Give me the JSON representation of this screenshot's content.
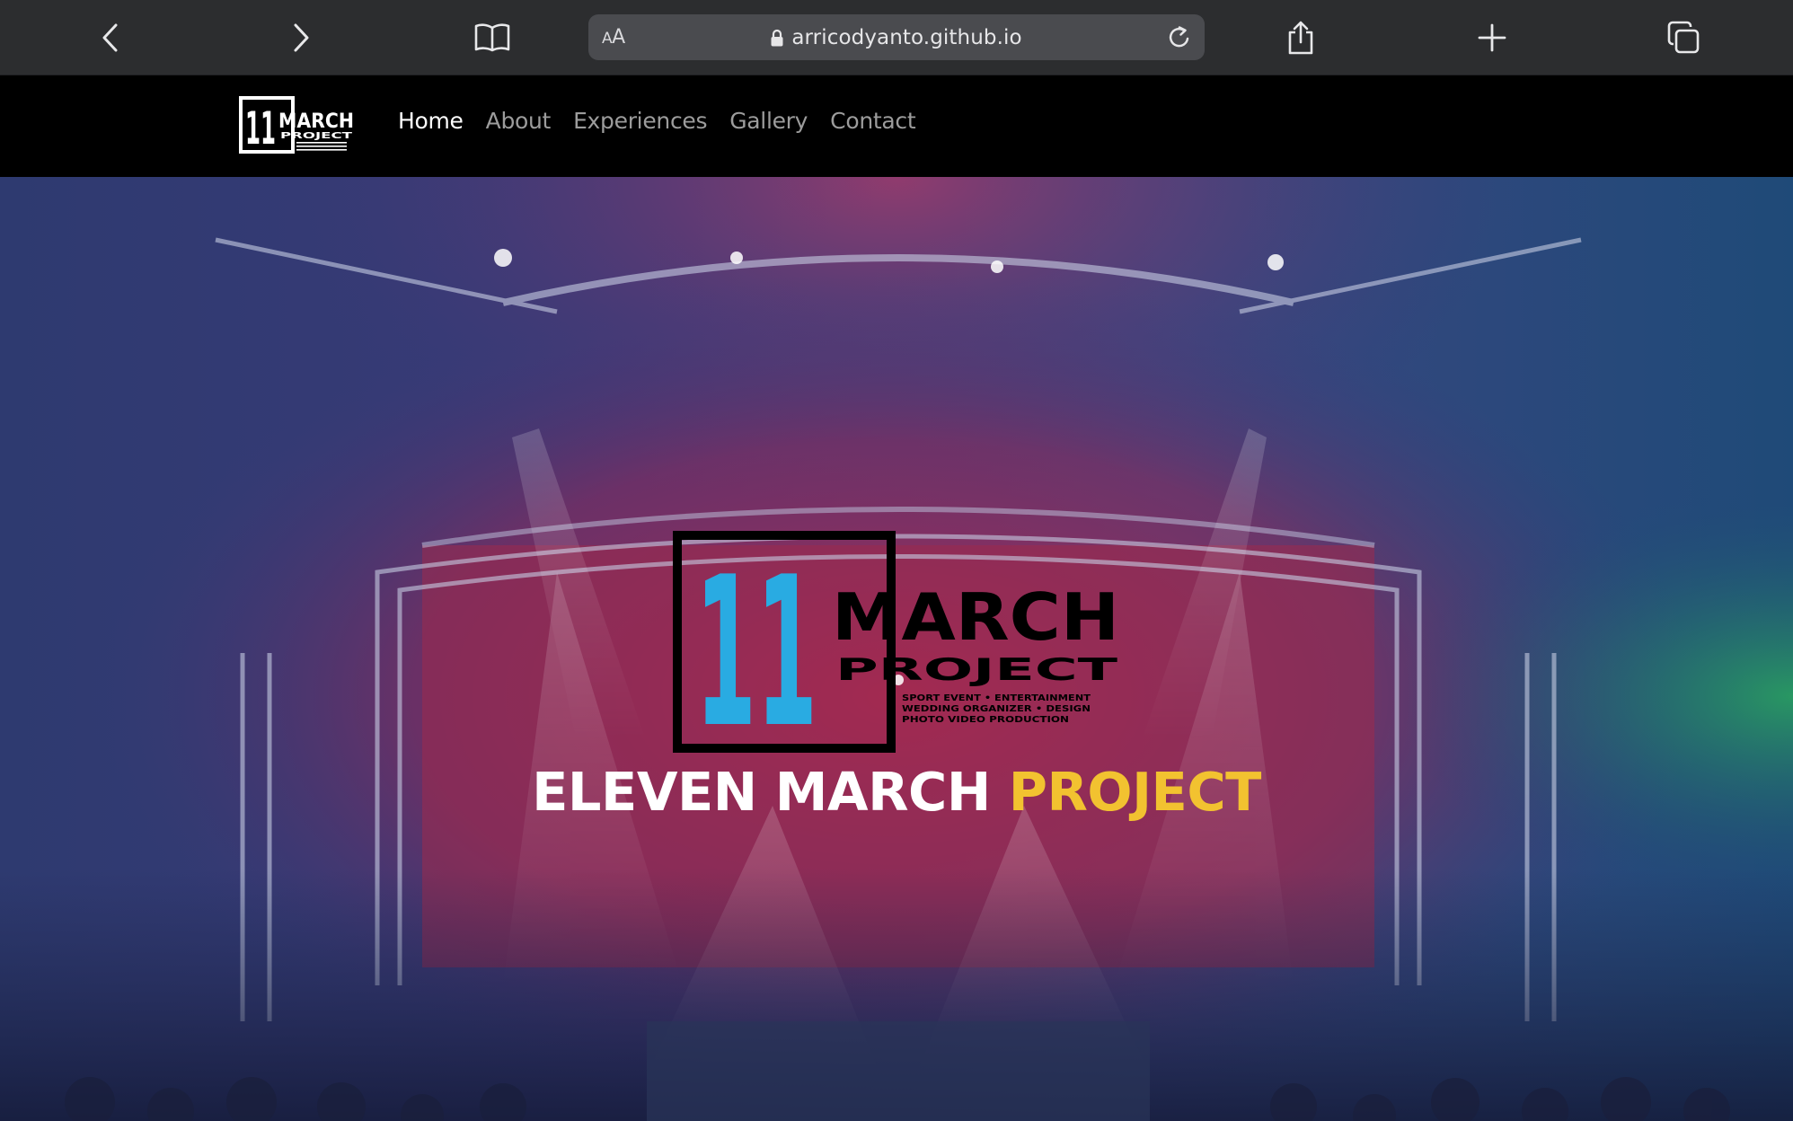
{
  "browser": {
    "reader_label": "AA",
    "url": "arricodyanto.github.io"
  },
  "nav": {
    "logo": {
      "number": "11",
      "word": "MARCH",
      "sub": "PROJECT"
    },
    "links": [
      {
        "label": "Home",
        "active": true
      },
      {
        "label": "About",
        "active": false
      },
      {
        "label": "Experiences",
        "active": false
      },
      {
        "label": "Gallery",
        "active": false
      },
      {
        "label": "Contact",
        "active": false
      }
    ]
  },
  "hero": {
    "logo": {
      "number": "11",
      "word": "MARCH",
      "sub": "PROJECT",
      "tagline": [
        "SPORT  EVENT • ENTERTAINMENT",
        "WEDDING  ORGANIZER • DESIGN",
        "PHOTO  VIDEO  PRODUCTION"
      ]
    },
    "title_main": "ELEVEN MARCH ",
    "title_highlight": "PROJECT"
  },
  "colors": {
    "toolbar_bg": "#2c2d2f",
    "address_bg": "#4a4b4f",
    "nav_bg": "#000000",
    "nav_active": "#ffffff",
    "nav_inactive": "#9c9c9c",
    "logo_blue": "#29abe2",
    "title_highlight": "#f2c230"
  }
}
